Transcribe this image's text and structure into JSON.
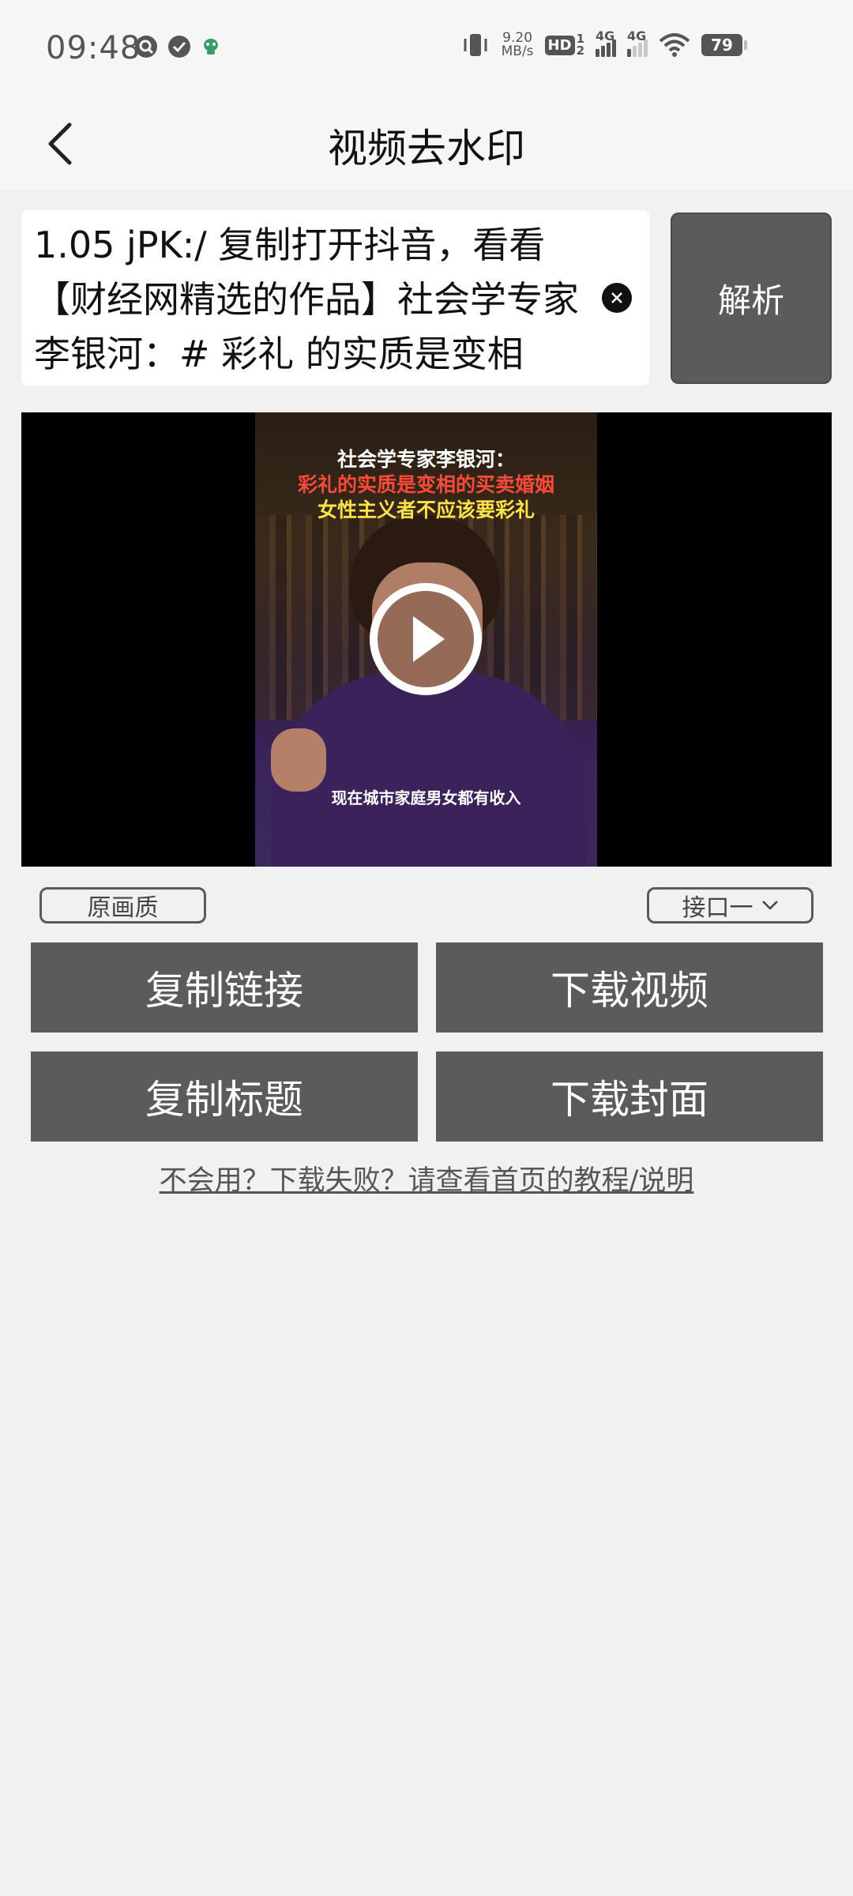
{
  "status_bar": {
    "time": "09:48",
    "net_speed_value": "9.20",
    "net_speed_unit": "MB/s",
    "hd_label": "HD",
    "hd_sub_top": "1",
    "hd_sub_bottom": "2",
    "signal1_label": "4G",
    "signal2_label": "4G",
    "battery": "79"
  },
  "header": {
    "title": "视频去水印"
  },
  "input": {
    "value": "1.05 jPK:/ 复制打开抖音，看看【财经网精选的作品】社会学专家李银河：# 彩礼 的实质是变相"
  },
  "parse_button": {
    "label": "解析"
  },
  "video": {
    "caption_line1": "社会学专家李银河：",
    "caption_line2": "彩礼的实质是变相的买卖婚姻",
    "caption_line3": "女性主义者不应该要彩礼",
    "subtitle": "现在城市家庭男女都有收入"
  },
  "options": {
    "quality_label": "原画质",
    "api_label": "接口一"
  },
  "actions": {
    "copy_link": "复制链接",
    "download_video": "下载视频",
    "copy_title": "复制标题",
    "download_cover": "下载封面"
  },
  "help_link": "不会用？下载失败？请查看首页的教程/说明",
  "icons": {
    "back": "chevron-left-icon",
    "clear": "close-circle-icon",
    "play": "play-icon",
    "dropdown": "chevron-down-icon",
    "vibrate": "vibrate-icon",
    "wifi": "wifi-icon"
  },
  "colors": {
    "button_bg": "#5b5b5b",
    "page_bg": "#f1f1f1",
    "header_bg": "#f6f6f6"
  }
}
